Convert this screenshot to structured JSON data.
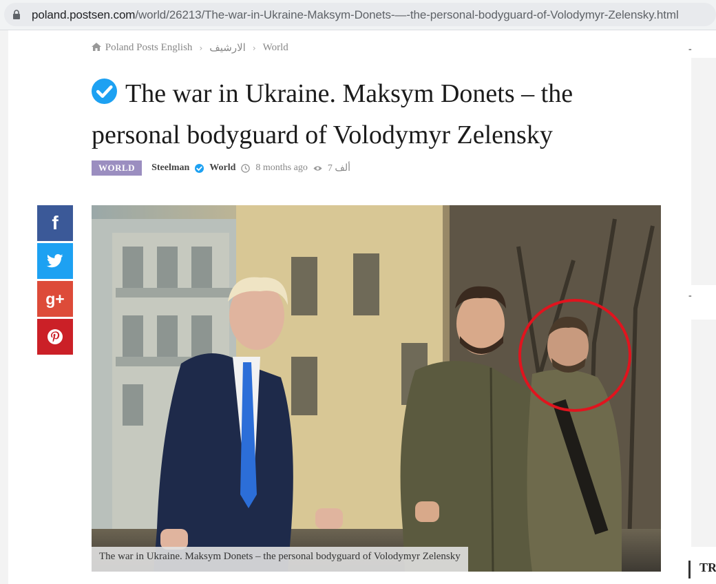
{
  "browser": {
    "url_host": "poland.postsen.com",
    "url_path": "/world/26213/The-war-in-Ukraine-Maksym-Donets-—-the-personal-bodyguard-of-Volodymyr-Zelensky.html"
  },
  "breadcrumb": {
    "home": "Poland Posts English",
    "archive": "الارشيف",
    "section": "World",
    "separator": "›"
  },
  "article": {
    "title": "The war in Ukraine. Maksym Donets – the personal bodyguard of Volodymyr Zelensky",
    "category_badge": "WORLD",
    "author": "Steelman",
    "category": "World",
    "time_ago": "8 months ago",
    "views": "7 ألف",
    "image_caption": "The war in Ukraine. Maksym Donets – the personal bodyguard of Volodymyr Zelensky"
  },
  "share": {
    "facebook": "f",
    "twitter": "twitter-icon",
    "googleplus": "g+",
    "pinterest": "pinterest-icon"
  },
  "sidebar": {
    "dash_top": "-",
    "dash_bottom": "-",
    "heading_partial": "TR"
  },
  "colors": {
    "badge": "#9b8ec0",
    "verified": "#1da1f2",
    "facebook": "#3b5998",
    "twitter": "#1da1f2",
    "googleplus": "#dd4b39",
    "pinterest": "#cb2027",
    "highlight_circle": "#e0141e"
  }
}
